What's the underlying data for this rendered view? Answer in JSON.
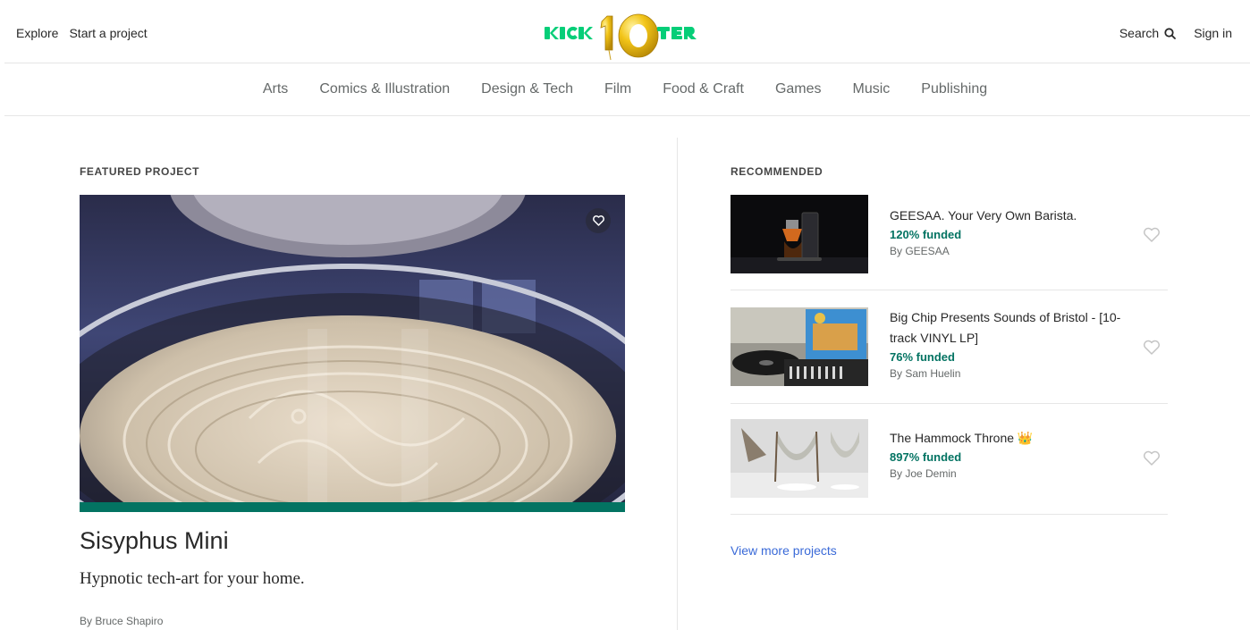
{
  "header": {
    "explore": "Explore",
    "start_project": "Start a project",
    "search": "Search",
    "sign_in": "Sign in",
    "logo_text": "KICKSTARTER"
  },
  "categories": [
    "Arts",
    "Comics & Illustration",
    "Design & Tech",
    "Film",
    "Food & Craft",
    "Games",
    "Music",
    "Publishing"
  ],
  "featured": {
    "label": "FEATURED PROJECT",
    "title": "Sisyphus Mini",
    "blurb": "Hypnotic tech-art for your home.",
    "by": "By Bruce Shapiro",
    "progress": 1.0
  },
  "recommended": {
    "label": "RECOMMENDED",
    "items": [
      {
        "title": "GEESAA. Your Very Own Barista.",
        "funded": "120% funded",
        "by": "By GEESAA"
      },
      {
        "title": "Big Chip Presents Sounds of Bristol - [10-track VINYL LP]",
        "funded": "76% funded",
        "by": "By Sam Huelin"
      },
      {
        "title": "The Hammock Throne 👑",
        "funded": "897% funded",
        "by": "By Joe Demin"
      }
    ],
    "view_more": "View more projects"
  },
  "colors": {
    "accent": "#037362",
    "link": "#3a6ad8"
  }
}
